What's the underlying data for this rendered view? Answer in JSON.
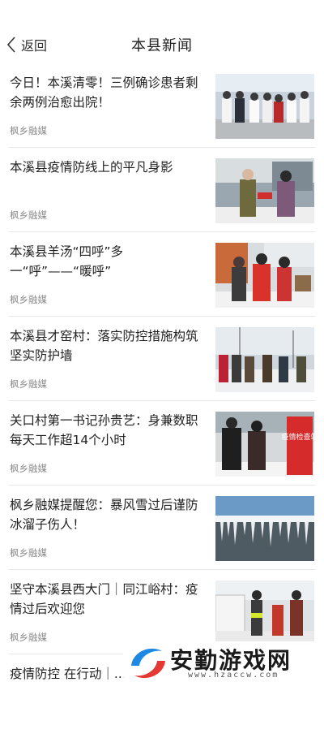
{
  "header": {
    "back_label": "返回",
    "title": "本县新闻"
  },
  "news": [
    {
      "title": "今日！本溪清零！三例确诊患者剩余两例治愈出院！",
      "source": "枫乡融媒",
      "image": "medical-staff-group-photo"
    },
    {
      "title": "本溪县疫情防线上的平凡身影",
      "source": "枫乡融媒",
      "image": "checkpoint-volunteers-photo"
    },
    {
      "title": "本溪县羊汤“四呼”多一“呼”——“暖呼”",
      "source": "枫乡融媒",
      "image": "volunteers-serving-soup-photo"
    },
    {
      "title": "本溪县才窑村：落实防控措施构筑坚实防护墙",
      "source": "枫乡融媒",
      "image": "village-road-checkpoint-photo"
    },
    {
      "title": "关口村第一书记孙贵艺：身兼数职 每天工作超14个小时",
      "source": "枫乡融媒",
      "image": "epidemic-checkpoint-station-photo",
      "sign_text": "疫情检查站"
    },
    {
      "title": "枫乡融媒提醒您：暴风雪过后谨防冰溜子伤人！",
      "source": "枫乡融媒",
      "image": "icicles-on-roof-photo"
    },
    {
      "title": "坚守本溪县西大门｜同江峪村：疫情过后欢迎您",
      "source": "枫乡融媒",
      "image": "roadside-checkpoint-photo"
    },
    {
      "title": "疫情防控 在行动｜...",
      "source": "",
      "image": ""
    }
  ],
  "watermark": {
    "text": "安勤游戏网",
    "url": "www.hzaccw.com"
  },
  "colors": {
    "title_text": "#222222",
    "source_text": "#8a8a8a",
    "divider": "#e8e8e8",
    "watermark_blue": "#1e88e5",
    "watermark_red": "#e53935"
  }
}
